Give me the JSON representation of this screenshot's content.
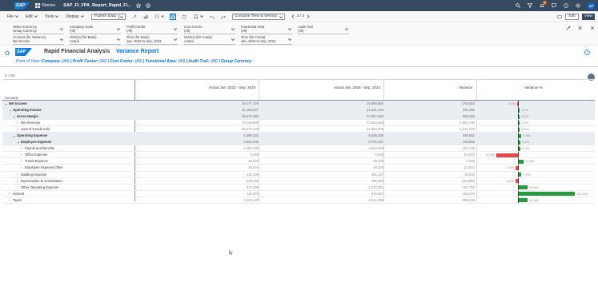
{
  "shell": {
    "logo": "SAP",
    "stories_label": "Stories",
    "title": "SAP_FI_FPA_Report_Rapid_Fi...",
    "notification_count": "1",
    "avatar_initials": "AF"
  },
  "toolbar": {
    "file": "File",
    "edit": "Edit",
    "tools": "Tools",
    "display": "Display",
    "publish": "Publish Data",
    "braces": "{ }",
    "version_select": "Compare Time & Version",
    "pager": "3 / 3",
    "edit_btn": "Edit",
    "view_btn": "View"
  },
  "filters": [
    {
      "label": "Select Currency",
      "value": "Group Currency"
    },
    {
      "label": "Company Code",
      "value": "(All)"
    },
    {
      "label": "Profit Center",
      "value": "(All)"
    },
    {
      "label": "Cost Center",
      "value": "(All)"
    },
    {
      "label": "Functional Area",
      "value": "(All)"
    },
    {
      "label": "Audit Trail",
      "value": "(All)"
    },
    {
      "label": "Account (for Variance)",
      "value": "Net Income"
    },
    {
      "label": "Version (for Base)",
      "value": "Actual"
    },
    {
      "label": "Time (for Base)",
      "value": "Jan, 2023 to Sep, 2023"
    },
    {
      "label": "Version (for Comp)",
      "value": "Actual"
    },
    {
      "label": "Time (for Comp)",
      "value": "Jan, 2024 to Sep, 2024"
    }
  ],
  "report": {
    "logo": "SAP",
    "app_title": "Rapid Financial Analysis",
    "report_title": "Variance Report",
    "pov_prefix": "Point of View:",
    "pov_parts": [
      "Company:",
      "(All)",
      "| Profit Center:",
      "(All)",
      "| Cost Center:",
      "(All)",
      "| Functional Area:",
      "(All)",
      "| Audit Trail:",
      "(All)",
      "| Group Currency"
    ]
  },
  "table": {
    "unit": "in USD",
    "account_header": "Account",
    "col_base": "Actual Jan, 2023 - Sep, 2023",
    "col_comp": "Actual Jan, 2024 - Sep, 2024",
    "col_var": "Variance",
    "col_varpct": "Variance %",
    "rows": [
      {
        "indent": 0,
        "toggle": "⌄",
        "name": "Net Income",
        "base": "19,177,479",
        "comp": "19,098,859",
        "var": "(78,620)",
        "pct": "-0.4%",
        "pctv": -0.4,
        "hl": true,
        "bold": true
      },
      {
        "indent": 1,
        "toggle": "⌄",
        "name": "Operating Income",
        "base": "21,185,027",
        "comp": "21,431,418",
        "var": "246,391",
        "pct": "1.2%",
        "pctv": 1.2,
        "hl": true,
        "bold": true
      },
      {
        "indent": 2,
        "toggle": "⌄",
        "name": "Gross Margin",
        "base": "26,474,460",
        "comp": "27,067,692",
        "var": "593,232",
        "pct": "2.2%",
        "pctv": 2.2,
        "hl": true,
        "bold": true
      },
      {
        "indent": 3,
        "toggle": "›",
        "name": "Net Revenue",
        "base": "72,748,888",
        "comp": "74,552,680",
        "var": "1,803,792",
        "pct": "2.5%",
        "pctv": 2.5,
        "hl": false,
        "bold": false
      },
      {
        "indent": 3,
        "toggle": "›",
        "name": "Cost of Goods Sold",
        "base": "46,274,428",
        "comp": "47,484,976",
        "var": "1,210,549",
        "pct": "2.6%",
        "pctv": 2.6,
        "hl": false,
        "bold": false
      },
      {
        "indent": 2,
        "toggle": "⌄",
        "name": "Operating Expense",
        "base": "5,289,433",
        "comp": "5,636,285",
        "var": "346,852",
        "pct": "6.6%",
        "pctv": 6.6,
        "hl": true,
        "bold": true
      },
      {
        "indent": 3,
        "toggle": "⌄",
        "name": "Employee Expense",
        "base": "3,553,635",
        "comp": "3,702,497",
        "var": "148,862",
        "pct": "4.2%",
        "pctv": 4.2,
        "hl": true,
        "bold": true
      },
      {
        "indent": 4,
        "toggle": "›",
        "name": "Payroll and Benefits",
        "base": "3,482,300",
        "comp": "3,634,049",
        "var": "151,749",
        "pct": "4.4%",
        "pctv": 4.4,
        "hl": false,
        "bold": false
      },
      {
        "indent": 4,
        "toggle": "›",
        "name": "Office Expense",
        "base": "9,059",
        "comp": "3,856",
        "var": "(5,203)",
        "pct": "-57.0%",
        "pctv": -57.0,
        "hl": false,
        "bold": false
      },
      {
        "indent": 4,
        "toggle": "›",
        "name": "Travel Expense",
        "base": "34,032",
        "comp": "38,300",
        "var": "4,268",
        "pct": "12.5%",
        "pctv": 12.5,
        "hl": false,
        "bold": false
      },
      {
        "indent": 4,
        "toggle": "›",
        "name": "Employee Expense Other",
        "base": "28,244",
        "comp": "26,223",
        "var": "(2,021)",
        "pct": "-7.2%",
        "pctv": -7.2,
        "hl": false,
        "bold": false
      },
      {
        "indent": 3,
        "toggle": "›",
        "name": "Building Expense",
        "base": "432,105",
        "comp": "462,147",
        "var": "30,042",
        "pct": "7.0%",
        "pctv": 7.0,
        "hl": false,
        "bold": false
      },
      {
        "indent": 3,
        "toggle": "›",
        "name": "Depreciation & Amortization",
        "base": "429,435",
        "comp": "399,600",
        "var": "(29,835)",
        "pct": "-6.9%",
        "pctv": -6.9,
        "hl": false,
        "bold": false
      },
      {
        "indent": 3,
        "toggle": "›",
        "name": "Other Operating Expense",
        "base": "874,259",
        "comp": "1,072,051",
        "var": "197,792",
        "pct": "22.6%",
        "pctv": 22.6,
        "hl": false,
        "bold": false
      },
      {
        "indent": 1,
        "toggle": "›",
        "name": "Interest",
        "base": "115,573",
        "comp": "279,997",
        "var": "164,424",
        "pct": "142.3%",
        "pctv": 142.3,
        "hl": false,
        "bold": false
      },
      {
        "indent": 1,
        "toggle": "›",
        "name": "Taxes",
        "base": "2,120,120",
        "comp": "2,611,356",
        "var": "489,236",
        "pct": "23.0%",
        "pctv": 23.0,
        "hl": false,
        "bold": false
      }
    ]
  },
  "colors": {
    "shell": "#354a5f",
    "positive": "#2b9a3f",
    "negative": "#e24a4a",
    "brand": "#0a6ed1"
  }
}
